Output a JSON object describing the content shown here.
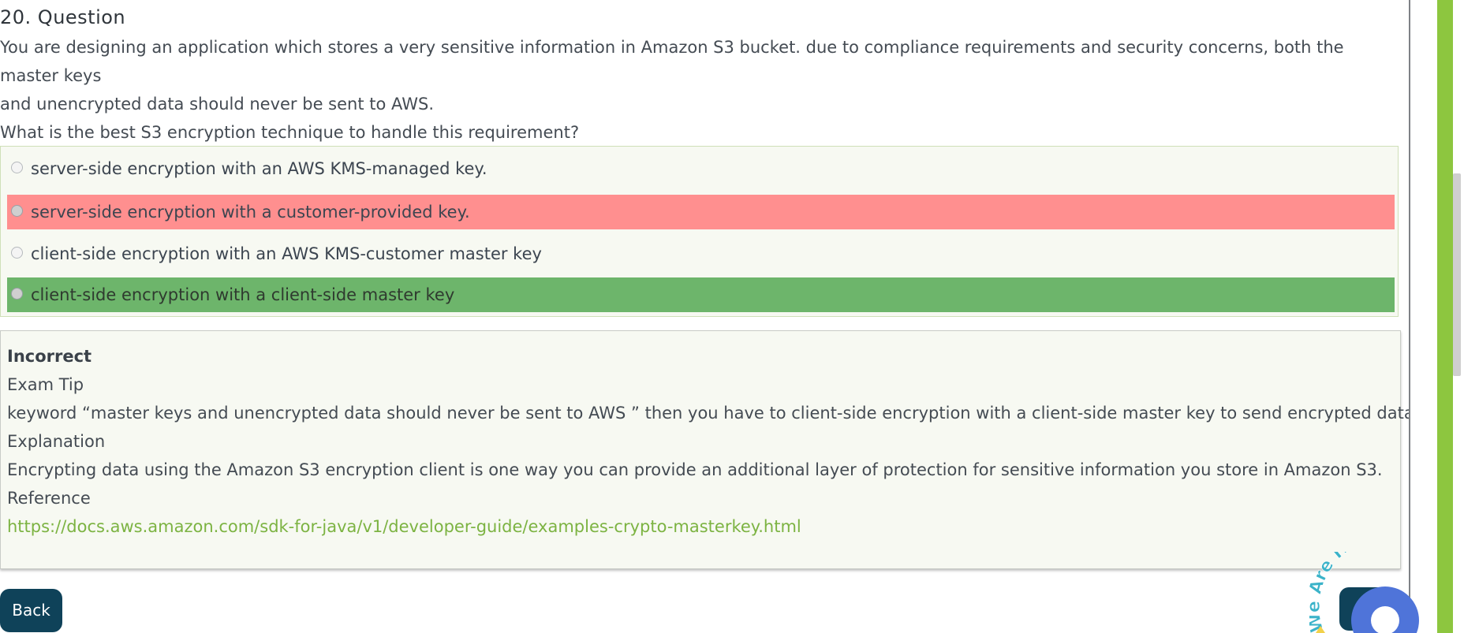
{
  "question": {
    "title": "20. Question",
    "text_line1": "You are designing an application which stores a very sensitive information in Amazon S3 bucket. due to compliance requirements and security concerns, both the master keys",
    "text_line2": "and unencrypted data should never be sent to AWS.",
    "text_line3": "What is the best S3 encryption technique to handle this requirement?"
  },
  "options": [
    {
      "label": "server-side encryption with an AWS KMS-managed key.",
      "state": "neutral"
    },
    {
      "label": "server-side encryption with a customer-provided key.",
      "state": "selected-incorrect"
    },
    {
      "label": "client-side encryption with an AWS KMS-customer master key",
      "state": "neutral"
    },
    {
      "label": "client-side encryption with a client-side master key",
      "state": "correct"
    }
  ],
  "explanation": {
    "verdict": "Incorrect",
    "tip_heading": "Exam Tip",
    "tip_text": "keyword  “master keys and unencrypted data should never be sent to AWS ” then you have to client-side encryption with a client-side master key to send encrypted data.",
    "explanation_heading": "Explanation",
    "explanation_text": "Encrypting data using the Amazon S3 encryption client is one way you can provide an additional layer of protection for sensitive information you store in Amazon S3.",
    "reference_heading": "Reference",
    "reference_link": "https://docs.aws.amazon.com/sdk-for-java/v1/developer-guide/examples-crypto-masterkey.html"
  },
  "nav": {
    "back_label": "Back"
  },
  "chat_widget": {
    "banner_text": "We Are Here!",
    "icon": "chat-bubble-icon"
  },
  "colors": {
    "incorrect_highlight": "#ff8f8f",
    "correct_highlight": "#6db56b",
    "link": "#7cb342",
    "button": "#0f4259",
    "accent_bar": "#8dc63f",
    "chat": "#4f74d9"
  }
}
